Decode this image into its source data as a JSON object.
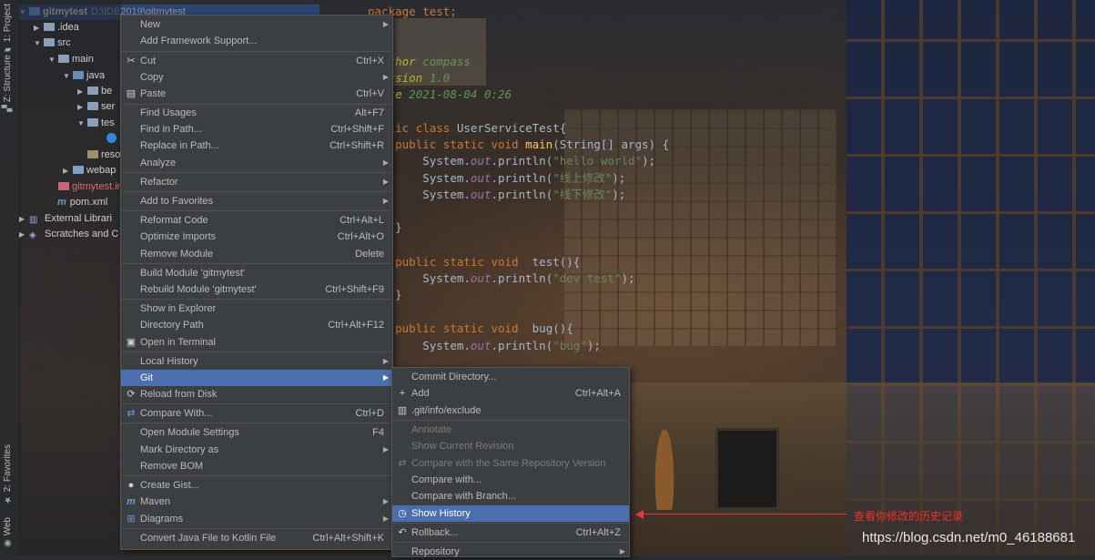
{
  "toolwindows": [
    {
      "label": "1: Project",
      "glyph": "▰"
    },
    {
      "label": "Z: Structure",
      "glyph": "▞"
    },
    {
      "label": "2: Favorites",
      "glyph": "★"
    },
    {
      "label": "Web",
      "glyph": "◉"
    }
  ],
  "tree": {
    "project_name": "gitmytest",
    "project_path": "D:\\IDE2019\\gitmytest",
    "items": {
      "idea": ".idea",
      "src": "src",
      "main": "main",
      "java": "java",
      "pkg1": "be",
      "pkg2": "ser",
      "pkg3": "tes",
      "resources": "resou",
      "webapp": "webap",
      "iml": "gitmytest.iml",
      "pom": "pom.xml",
      "ext": "External Librari",
      "scratches": "Scratches and C"
    }
  },
  "editor": {
    "l1": "package test;",
    "l2_tag": "@author",
    "l2_val": "compass",
    "l3_tag": "@version",
    "l3_val": "1.0",
    "l4_tag": "@date",
    "l4_val": "2021-08-04 0:26",
    "l5_kw": "public class",
    "l5_rest": "UserServiceTest{",
    "l6_kw": "public static void",
    "l6_fn": "main",
    "l6_rest": "(String[] args) {",
    "sys": "System.",
    "out": "out",
    "println": ".println(",
    "s1": "\"hello world\"",
    "s2": "\"线上修改\"",
    "s3": "\"线下修改\"",
    "end": ");",
    "close": "}",
    "l_test_kw": "public static void",
    "l_test": "test(){",
    "s4": "\"dev test\"",
    "l_bug_kw": "public static void",
    "l_bug": "bug(){",
    "s5": "\"bug\""
  },
  "context_menu": [
    {
      "label": "New",
      "shortcut": "",
      "submenu": true
    },
    {
      "label": "Add Framework Support...",
      "shortcut": ""
    },
    {
      "label": "Cut",
      "shortcut": "Ctrl+X",
      "icon": "scissors-icon"
    },
    {
      "label": "Copy",
      "shortcut": "",
      "submenu": true
    },
    {
      "label": "Paste",
      "shortcut": "Ctrl+V",
      "icon": "paste-icon"
    },
    {
      "label": "Find Usages",
      "shortcut": "Alt+F7"
    },
    {
      "label": "Find in Path...",
      "shortcut": "Ctrl+Shift+F"
    },
    {
      "label": "Replace in Path...",
      "shortcut": "Ctrl+Shift+R"
    },
    {
      "label": "Analyze",
      "shortcut": "",
      "submenu": true
    },
    {
      "label": "Refactor",
      "shortcut": "",
      "submenu": true
    },
    {
      "label": "Add to Favorites",
      "shortcut": "",
      "submenu": true
    },
    {
      "label": "Reformat Code",
      "shortcut": "Ctrl+Alt+L"
    },
    {
      "label": "Optimize Imports",
      "shortcut": "Ctrl+Alt+O"
    },
    {
      "label": "Remove Module",
      "shortcut": "Delete"
    },
    {
      "label": "Build Module 'gitmytest'",
      "shortcut": ""
    },
    {
      "label": "Rebuild Module 'gitmytest'",
      "shortcut": "Ctrl+Shift+F9"
    },
    {
      "label": "Show in Explorer",
      "shortcut": ""
    },
    {
      "label": "Directory Path",
      "shortcut": "Ctrl+Alt+F12"
    },
    {
      "label": "Open in Terminal",
      "shortcut": "",
      "icon": "terminal-icon"
    },
    {
      "label": "Local History",
      "shortcut": "",
      "submenu": true
    },
    {
      "label": "Git",
      "shortcut": "",
      "submenu": true
    },
    {
      "label": "Reload from Disk",
      "shortcut": "",
      "icon": "reload-icon"
    },
    {
      "label": "Compare With...",
      "shortcut": "Ctrl+D",
      "icon": "compare-icon"
    },
    {
      "label": "Open Module Settings",
      "shortcut": "F4"
    },
    {
      "label": "Mark Directory as",
      "shortcut": "",
      "submenu": true
    },
    {
      "label": "Remove BOM",
      "shortcut": ""
    },
    {
      "label": "Create Gist...",
      "shortcut": "",
      "icon": "github-icon"
    },
    {
      "label": "Maven",
      "shortcut": "",
      "submenu": true,
      "icon": "maven-icon"
    },
    {
      "label": "Diagrams",
      "shortcut": "",
      "submenu": true,
      "icon": "diagram-icon"
    },
    {
      "label": "Convert Java File to Kotlin File",
      "shortcut": "Ctrl+Alt+Shift+K"
    }
  ],
  "git_menu": [
    {
      "label": "Commit Directory...",
      "shortcut": ""
    },
    {
      "label": "Add",
      "shortcut": "Ctrl+Alt+A",
      "icon": "plus-icon"
    },
    {
      "label": ".git/info/exclude",
      "shortcut": "",
      "icon": "file-icon"
    },
    {
      "label": "Annotate",
      "shortcut": ""
    },
    {
      "label": "Show Current Revision",
      "shortcut": ""
    },
    {
      "label": "Compare with the Same Repository Version",
      "shortcut": ""
    },
    {
      "label": "Compare with...",
      "shortcut": ""
    },
    {
      "label": "Compare with Branch...",
      "shortcut": ""
    },
    {
      "label": "Show History",
      "shortcut": "",
      "icon": "clock-icon"
    },
    {
      "label": "Rollback...",
      "shortcut": "Ctrl+Alt+Z",
      "icon": "rollback-icon"
    },
    {
      "label": "Repository",
      "shortcut": "",
      "submenu": true
    }
  ],
  "annotation_note": "查看你修改的历史记录",
  "watermark": "https://blog.csdn.net/m0_46188681",
  "colors": {
    "highlight": "#4b6eaf",
    "menu_bg": "#3c3f41",
    "annotation_red": "#e03a3a"
  }
}
